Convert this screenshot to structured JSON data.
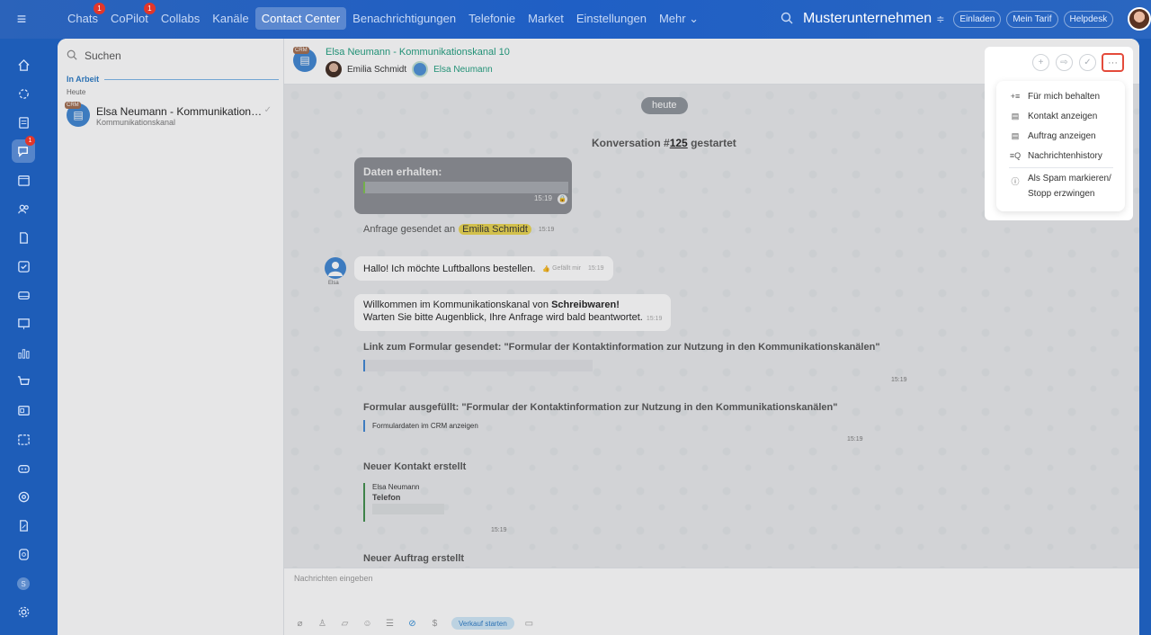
{
  "topbar": {
    "menu_icon": "hamburger-icon",
    "nav": [
      {
        "label": "Chats",
        "badge": "1"
      },
      {
        "label": "CoPilot",
        "badge": "1"
      },
      {
        "label": "Collabs"
      },
      {
        "label": "Kanäle"
      },
      {
        "label": "Contact Center",
        "active": true
      },
      {
        "label": "Benachrichtigungen"
      },
      {
        "label": "Telefonie"
      },
      {
        "label": "Market"
      },
      {
        "label": "Einstellungen"
      },
      {
        "label": "Mehr ⌄"
      }
    ],
    "company": "Musterunternehmen",
    "invite": "Einladen",
    "plan": "Mein Tarif",
    "helpdesk": "Helpdesk"
  },
  "leftbar": {
    "chat_badge": "1",
    "user_initial": "S"
  },
  "sidebar": {
    "search_placeholder": "Suchen",
    "section": "In Arbeit",
    "group": "Heute",
    "items": [
      {
        "title": "Elsa Neumann - Kommunikationsk...",
        "subtitle": "Kommunikationskanal",
        "tag": "CRM"
      }
    ]
  },
  "chat": {
    "title": "Elsa Neumann - Kommunikationskanal 10",
    "tag": "CRM",
    "operator": "Emilia Schmidt",
    "client": "Elsa Neumann",
    "date_pill": "heute",
    "system_prefix": "Konversation #",
    "conversation_no": "125",
    "system_suffix": " gestartet",
    "data_received": "Daten erhalten:",
    "data_time": "15:19",
    "request_sent": "Anfrage gesendet an",
    "request_user": "Emilia Schmidt",
    "request_time": "15:19",
    "client_label": "Elsa",
    "msg1": "Hallo! Ich möchte Luftballons bestellen.",
    "msg1_like": "Gefällt mir",
    "msg1_time": "15:19",
    "msg2_pre": "Willkommen im Kommunikationskanal von ",
    "msg2_bold": "Schreibwaren!",
    "msg2_line2": "Warten Sie bitte Augenblick, Ihre Anfrage wird bald beantwortet.",
    "msg2_time": "15:19",
    "link_title": "Link zum Formular gesendet: \"Formular der Kontaktinformation zur Nutzung in den Kommunikationskanälen\"",
    "link_time": "15:19",
    "form_title": "Formular ausgefüllt: \"Formular der Kontaktinformation zur Nutzung in den Kommunikationskanälen\"",
    "form_link": "Formulardaten im CRM anzeigen",
    "form_time": "15:19",
    "contact_title": "Neuer Kontakt erstellt",
    "contact_name": "Elsa Neumann",
    "contact_phone": "Telefon",
    "contact_time": "15:19",
    "order_title": "Neuer Auftrag erstellt",
    "composer_placeholder": "Nachrichten eingeben",
    "sale_button": "Verkauf starten"
  },
  "menu": {
    "items": [
      {
        "label": "Für mich behalten",
        "icon": "pin-icon"
      },
      {
        "label": "Kontakt anzeigen",
        "icon": "contact-card-icon"
      },
      {
        "label": "Auftrag anzeigen",
        "icon": "order-card-icon"
      },
      {
        "label": "Nachrichtenhistory",
        "icon": "history-search-icon"
      },
      {
        "label": "Als Spam markieren/",
        "label2": "Stopp erzwingen",
        "icon": "spam-icon"
      }
    ]
  }
}
